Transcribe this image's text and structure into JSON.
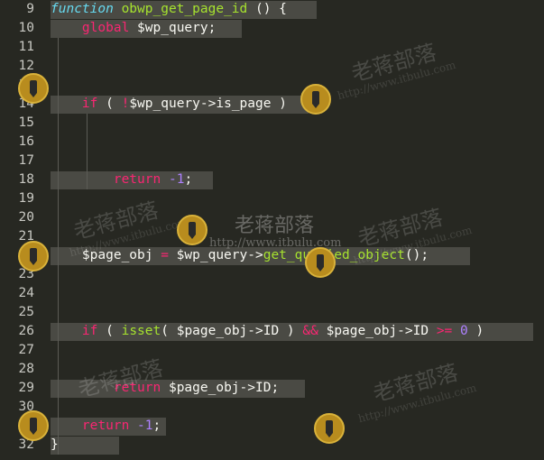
{
  "editor": {
    "lines": [
      {
        "num": "9",
        "tokens": [
          {
            "t": "function",
            "c": "it"
          },
          {
            "t": " ",
            "c": "pl"
          },
          {
            "t": "obwp_get_page_id",
            "c": "fn"
          },
          {
            "t": " () {",
            "c": "pl"
          }
        ]
      },
      {
        "num": "10",
        "tokens": [
          {
            "t": "    ",
            "c": "pl"
          },
          {
            "t": "global",
            "c": "kw"
          },
          {
            "t": " $wp_query;",
            "c": "pl"
          }
        ]
      },
      {
        "num": "11",
        "tokens": []
      },
      {
        "num": "12",
        "tokens": []
      },
      {
        "num": "13",
        "tokens": []
      },
      {
        "num": "14",
        "tokens": [
          {
            "t": "    ",
            "c": "pl"
          },
          {
            "t": "if",
            "c": "kw"
          },
          {
            "t": " ( ",
            "c": "pl"
          },
          {
            "t": "!",
            "c": "kw"
          },
          {
            "t": "$wp_query->is_page )",
            "c": "pl"
          }
        ]
      },
      {
        "num": "15",
        "tokens": []
      },
      {
        "num": "16",
        "tokens": []
      },
      {
        "num": "17",
        "tokens": []
      },
      {
        "num": "18",
        "tokens": [
          {
            "t": "        ",
            "c": "pl"
          },
          {
            "t": "return",
            "c": "kw"
          },
          {
            "t": " ",
            "c": "pl"
          },
          {
            "t": "-1",
            "c": "num"
          },
          {
            "t": ";",
            "c": "pl"
          }
        ]
      },
      {
        "num": "19",
        "tokens": []
      },
      {
        "num": "20",
        "tokens": []
      },
      {
        "num": "21",
        "tokens": []
      },
      {
        "num": "22",
        "tokens": [
          {
            "t": "    $page_obj ",
            "c": "pl"
          },
          {
            "t": "=",
            "c": "kw"
          },
          {
            "t": " $wp_query->",
            "c": "pl"
          },
          {
            "t": "get_queried_object",
            "c": "fn"
          },
          {
            "t": "();",
            "c": "pl"
          }
        ]
      },
      {
        "num": "23",
        "tokens": []
      },
      {
        "num": "24",
        "tokens": []
      },
      {
        "num": "25",
        "tokens": []
      },
      {
        "num": "26",
        "tokens": [
          {
            "t": "    ",
            "c": "pl"
          },
          {
            "t": "if",
            "c": "kw"
          },
          {
            "t": " ( ",
            "c": "pl"
          },
          {
            "t": "isset",
            "c": "fn"
          },
          {
            "t": "( $page_obj->ID ) ",
            "c": "pl"
          },
          {
            "t": "&&",
            "c": "kw"
          },
          {
            "t": " $page_obj->ID ",
            "c": "pl"
          },
          {
            "t": ">=",
            "c": "kw"
          },
          {
            "t": " ",
            "c": "pl"
          },
          {
            "t": "0",
            "c": "num"
          },
          {
            "t": " )",
            "c": "pl"
          }
        ]
      },
      {
        "num": "27",
        "tokens": []
      },
      {
        "num": "28",
        "tokens": []
      },
      {
        "num": "29",
        "tokens": [
          {
            "t": "        ",
            "c": "pl"
          },
          {
            "t": "return",
            "c": "kw"
          },
          {
            "t": " $page_obj->ID;",
            "c": "pl"
          }
        ]
      },
      {
        "num": "30",
        "tokens": []
      },
      {
        "num": "31",
        "tokens": [
          {
            "t": "    ",
            "c": "pl"
          },
          {
            "t": "return",
            "c": "kw"
          },
          {
            "t": " ",
            "c": "pl"
          },
          {
            "t": "-1",
            "c": "num"
          },
          {
            "t": ";",
            "c": "pl"
          }
        ]
      },
      {
        "num": "32",
        "tokens": [
          {
            "t": "}",
            "c": "pl"
          }
        ]
      }
    ]
  },
  "watermark": {
    "text": "老蒋部落",
    "url": "http://www.itbulu.com"
  }
}
